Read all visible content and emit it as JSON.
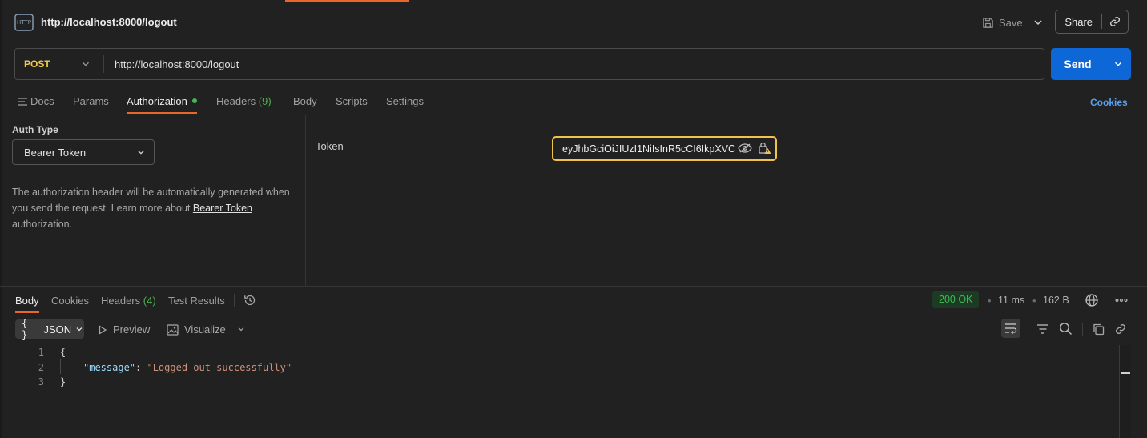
{
  "header": {
    "title": "http://localhost:8000/logout",
    "save_label": "Save",
    "share_label": "Share"
  },
  "request": {
    "method": "POST",
    "url": "http://localhost:8000/logout",
    "send_label": "Send",
    "method_color": "#f2c94c"
  },
  "tabs": {
    "docs": "Docs",
    "params": "Params",
    "authorization": "Authorization",
    "headers": "Headers",
    "headers_count": "(9)",
    "body": "Body",
    "scripts": "Scripts",
    "settings": "Settings",
    "cookies": "Cookies"
  },
  "auth": {
    "type_label": "Auth Type",
    "type_value": "Bearer Token",
    "desc_before": "The authorization header will be automatically generated when you send the request. Learn more about",
    "desc_link": "Bearer Token",
    "desc_after": "authorization.",
    "token_label": "Token",
    "token_value": "eyJhbGciOiJIUzI1NiIsInR5cCI6IkpXVC"
  },
  "response": {
    "tabs": {
      "body": "Body",
      "cookies": "Cookies",
      "headers": "Headers",
      "headers_count": "(4)",
      "test_results": "Test Results"
    },
    "status": "200 OK",
    "time": "11 ms",
    "size": "162 B",
    "format": "JSON",
    "preview_label": "Preview",
    "visualize_label": "Visualize",
    "lines": {
      "n1": "1",
      "n2": "2",
      "n3": "3",
      "open": "{",
      "key": "\"message\"",
      "colon": ": ",
      "value": "\"Logged out successfully\"",
      "close": "}"
    }
  },
  "colors": {
    "accent": "#e7682a",
    "send": "#0e67d6",
    "status_ok": "#3fb950",
    "token_border": "#f2c24a"
  }
}
